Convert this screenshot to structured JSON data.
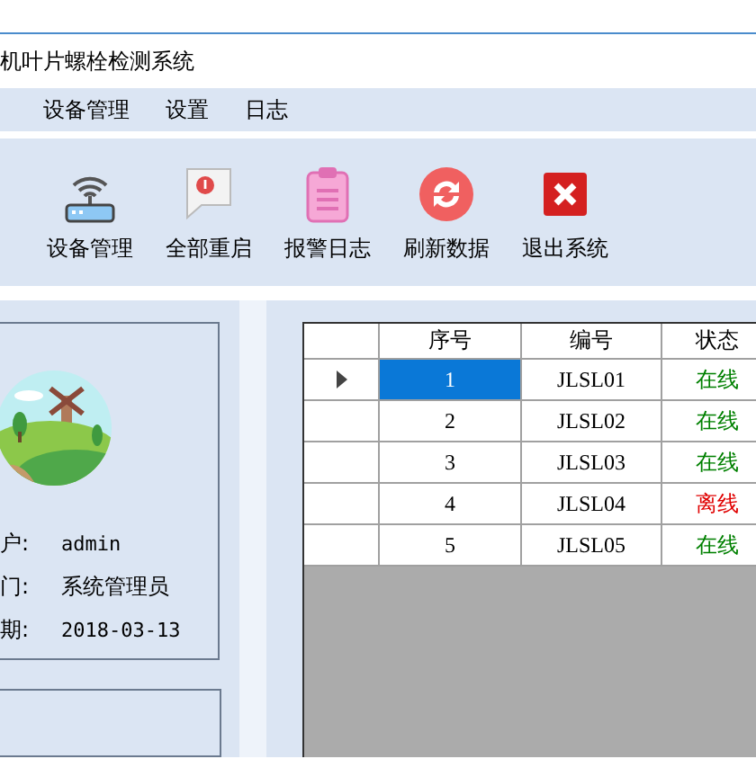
{
  "window": {
    "title": "机叶片螺栓检测系统"
  },
  "menu": [
    "设备管理",
    "设置",
    "日志"
  ],
  "toolbar": [
    {
      "kind": "router",
      "label": "设备管理"
    },
    {
      "kind": "message",
      "label": "全部重启"
    },
    {
      "kind": "clipboard",
      "label": "报警日志"
    },
    {
      "kind": "refresh",
      "label": "刷新数据"
    },
    {
      "kind": "exit",
      "label": "退出系统"
    }
  ],
  "user": {
    "fields": [
      {
        "label": "户:",
        "value": "admin"
      },
      {
        "label": "门:",
        "value": "系统管理员"
      },
      {
        "label": "期:",
        "value": "2018-03-13"
      }
    ]
  },
  "table": {
    "columns": [
      "序号",
      "编号",
      "状态"
    ],
    "rows": [
      {
        "selected": true,
        "cells": [
          "1",
          "JLSL01",
          "在线"
        ],
        "color": "#008000"
      },
      {
        "selected": false,
        "cells": [
          "2",
          "JLSL02",
          "在线"
        ],
        "color": "#008000"
      },
      {
        "selected": false,
        "cells": [
          "3",
          "JLSL03",
          "在线"
        ],
        "color": "#008000"
      },
      {
        "selected": false,
        "cells": [
          "4",
          "JLSL04",
          "离线"
        ],
        "color": "#e00000"
      },
      {
        "selected": false,
        "cells": [
          "5",
          "JLSL05",
          "在线"
        ],
        "color": "#008000"
      }
    ]
  }
}
